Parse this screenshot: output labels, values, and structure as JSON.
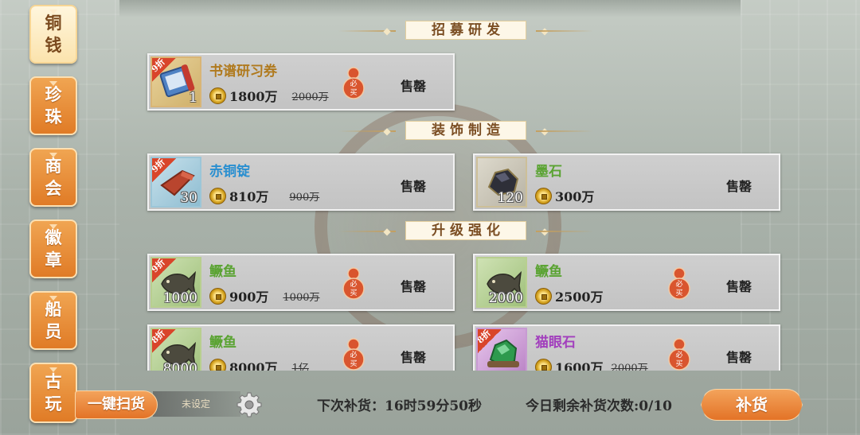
{
  "colors": {
    "accent": "#e37327",
    "tab_active_bg": "#fbe3ad",
    "sold_text": "#222222",
    "discount_ribbon": "#d9452a"
  },
  "sidebar": {
    "tabs": [
      {
        "label": [
          "铜",
          "钱"
        ],
        "active": true
      },
      {
        "label": [
          "珍",
          "珠"
        ],
        "active": false
      },
      {
        "label": [
          "商",
          "会"
        ],
        "active": false
      },
      {
        "label": [
          "徽",
          "章"
        ],
        "active": false
      },
      {
        "label": [
          "船",
          "员"
        ],
        "active": false
      },
      {
        "label": [
          "古",
          "玩"
        ],
        "active": false
      }
    ]
  },
  "sections": [
    {
      "title": "招募研发"
    },
    {
      "title": "装饰制造"
    },
    {
      "title": "升级强化"
    }
  ],
  "items": [
    {
      "name": "书谱研习券",
      "qty": "1",
      "discount": "9折",
      "price": "1800万",
      "orig_price": "2000万",
      "badge": [
        "必",
        "买"
      ],
      "status": "售罄",
      "icon": "scroll-ticket-icon"
    },
    {
      "name": "赤铜锭",
      "qty": "30",
      "discount": "9折",
      "price": "810万",
      "orig_price": "900万",
      "status": "售罄",
      "icon": "copper-ingot-icon"
    },
    {
      "name": "墨石",
      "qty": "120",
      "price": "300万",
      "status": "售罄",
      "icon": "ink-stone-icon"
    },
    {
      "name": "鳜鱼",
      "qty": "1000",
      "discount": "9折",
      "price": "900万",
      "orig_price": "1000万",
      "badge": [
        "必",
        "买"
      ],
      "status": "售罄",
      "icon": "fish-icon"
    },
    {
      "name": "鳜鱼",
      "qty": "2000",
      "price": "2500万",
      "badge": [
        "必",
        "买"
      ],
      "status": "售罄",
      "icon": "fish-icon"
    },
    {
      "name": "鳜鱼",
      "qty": "8000",
      "discount": "8折",
      "price": "8000万",
      "orig_price": "1亿",
      "badge": [
        "必",
        "买"
      ],
      "status": "售罄",
      "icon": "fish-icon"
    },
    {
      "name": "猫眼石",
      "discount": "8折",
      "price": "1600万",
      "orig_price": "2000万",
      "badge": [
        "必",
        "买"
      ],
      "status": "售罄",
      "icon": "cats-eye-gem-icon"
    }
  ],
  "bottom": {
    "sweep_label": "一键扫货",
    "unset_label": "未设定",
    "restock_timer": "下次补货：16时59分50秒",
    "restock_count": "今日剩余补货次数:0/10",
    "restock_button": "补货"
  }
}
